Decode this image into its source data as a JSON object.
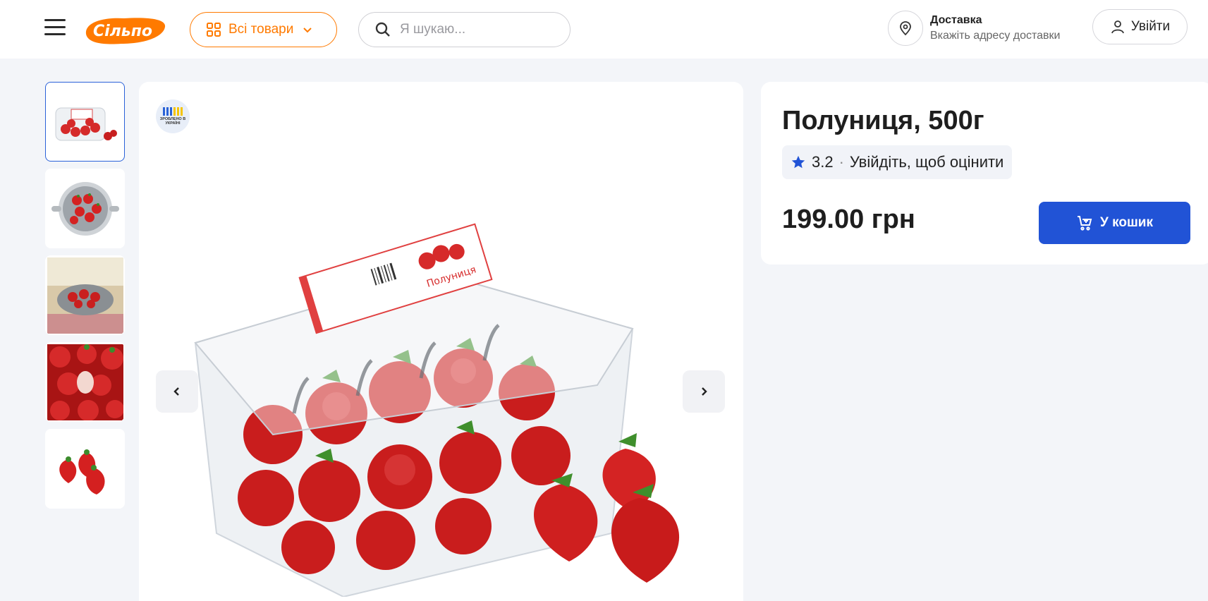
{
  "header": {
    "logo_text": "Сільпо",
    "catalog_label": "Всі товари",
    "search_placeholder": "Я шукаю...",
    "delivery_title": "Доставка",
    "delivery_subtitle": "Вкажіть адресу доставки",
    "login_label": "Увійти"
  },
  "gallery": {
    "badge_text": "ЗРОБЛЕНО В УКРАЇНІ",
    "thumbnails": [
      {
        "name": "strawberry-box"
      },
      {
        "name": "strawberry-colander"
      },
      {
        "name": "strawberry-held-bowl"
      },
      {
        "name": "strawberry-closeup"
      },
      {
        "name": "strawberry-three"
      }
    ],
    "active_index": 0,
    "package_label": "Полуниця"
  },
  "product": {
    "title": "Полуниця, 500г",
    "rating": "3.2",
    "rating_separator": "·",
    "rating_prompt": "Увійдіть, щоб оцінити",
    "price": "199.00 грн",
    "cart_label": "У кошик"
  },
  "colors": {
    "brand_orange": "#ff7a00",
    "accent_blue": "#2153d6",
    "background": "#f3f5f9"
  }
}
